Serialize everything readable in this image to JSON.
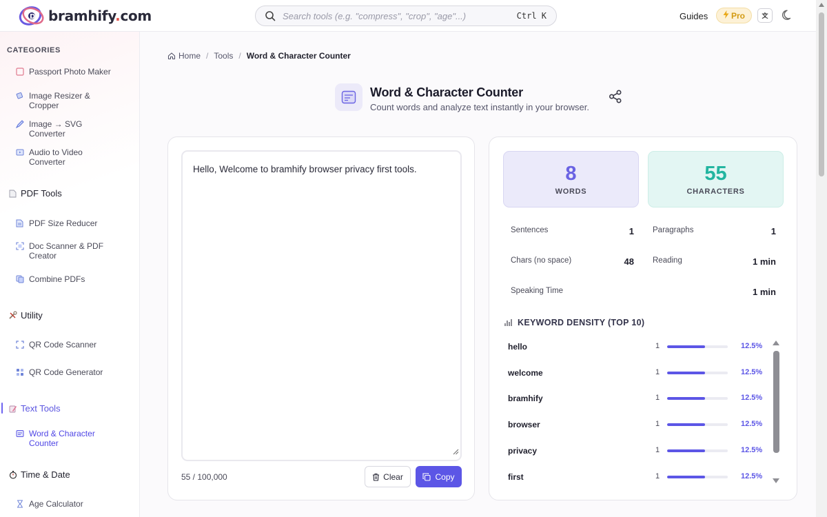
{
  "header": {
    "logo_text": "bramhify",
    "logo_dot": ".",
    "logo_suffix": "com",
    "search_placeholder": "Search tools (e.g. \"compress\", \"crop\", \"age\"...)",
    "search_shortcut": "Ctrl K",
    "nav_guides": "Guides",
    "nav_pro": "Pro",
    "nav_lang": "🇮🇳"
  },
  "sidebar": {
    "categories_title": "CATEGORIES",
    "items": [
      {
        "label_lines": [
          "Passport Photo Maker"
        ],
        "icon": "passport-icon"
      },
      {
        "label_lines": [
          "Image Resizer &",
          "Cropper"
        ],
        "icon": "resize-icon"
      },
      {
        "label_lines": [
          "Image → SVG",
          "Converter"
        ],
        "icon": "svg-icon"
      },
      {
        "label_lines": [
          "Audio to Video",
          "Converter"
        ],
        "icon": "video-icon"
      }
    ],
    "groups": {
      "pdf": {
        "label": "PDF Tools",
        "items": [
          {
            "label_lines": [
              "PDF Size Reducer"
            ]
          },
          {
            "label_lines": [
              "Doc Scanner & PDF",
              "Creator"
            ]
          },
          {
            "label_lines": [
              "Combine PDFs"
            ]
          }
        ]
      },
      "utility": {
        "label": "Utility",
        "items": [
          {
            "label_lines": [
              "QR Code Scanner"
            ]
          },
          {
            "label_lines": [
              "QR Code Generator"
            ]
          }
        ]
      },
      "text": {
        "label": "Text Tools",
        "items": [
          {
            "label_lines": [
              "Word & Character",
              "Counter"
            ]
          }
        ]
      },
      "time": {
        "label": "Time & Date",
        "items": [
          {
            "label_lines": [
              "Age Calculator"
            ]
          }
        ]
      }
    }
  },
  "breadcrumb": {
    "home": "Home",
    "tools": "Tools",
    "current": "Word & Character Counter",
    "sep": "/"
  },
  "tool": {
    "title": "Word & Character Counter",
    "subtitle": "Count words and analyze text instantly in your browser."
  },
  "editor": {
    "text": "Hello, Welcome to bramhify browser privacy first tools.",
    "char_count": "55 / 100,000",
    "clear_label": "Clear",
    "copy_label": "Copy"
  },
  "stats": {
    "words_value": "8",
    "words_label": "WORDS",
    "chars_value": "55",
    "chars_label": "CHARACTERS",
    "sentences_label": "Sentences",
    "sentences_value": "1",
    "paragraphs_label": "Paragraphs",
    "paragraphs_value": "1",
    "chars_no_space_label": "Chars (no space)",
    "chars_no_space_value": "48",
    "reading_label": "Reading",
    "reading_value": "1 min",
    "speaking_label": "Speaking Time",
    "speaking_value": "1 min"
  },
  "keyword_density": {
    "title": "KEYWORD DENSITY (TOP 10)",
    "rows": [
      {
        "word": "hello",
        "count": "1",
        "percent": "12.5%",
        "fraction": 0.125
      },
      {
        "word": "welcome",
        "count": "1",
        "percent": "12.5%",
        "fraction": 0.125
      },
      {
        "word": "bramhify",
        "count": "1",
        "percent": "12.5%",
        "fraction": 0.125
      },
      {
        "word": "browser",
        "count": "1",
        "percent": "12.5%",
        "fraction": 0.125
      },
      {
        "word": "privacy",
        "count": "1",
        "percent": "12.5%",
        "fraction": 0.125
      },
      {
        "word": "first",
        "count": "1",
        "percent": "12.5%",
        "fraction": 0.125
      }
    ]
  },
  "colors": {
    "accent": "#5c56e6",
    "words_accent": "#6a63e3",
    "chars_accent": "#22b5a0",
    "pro_accent": "#d39a12"
  }
}
